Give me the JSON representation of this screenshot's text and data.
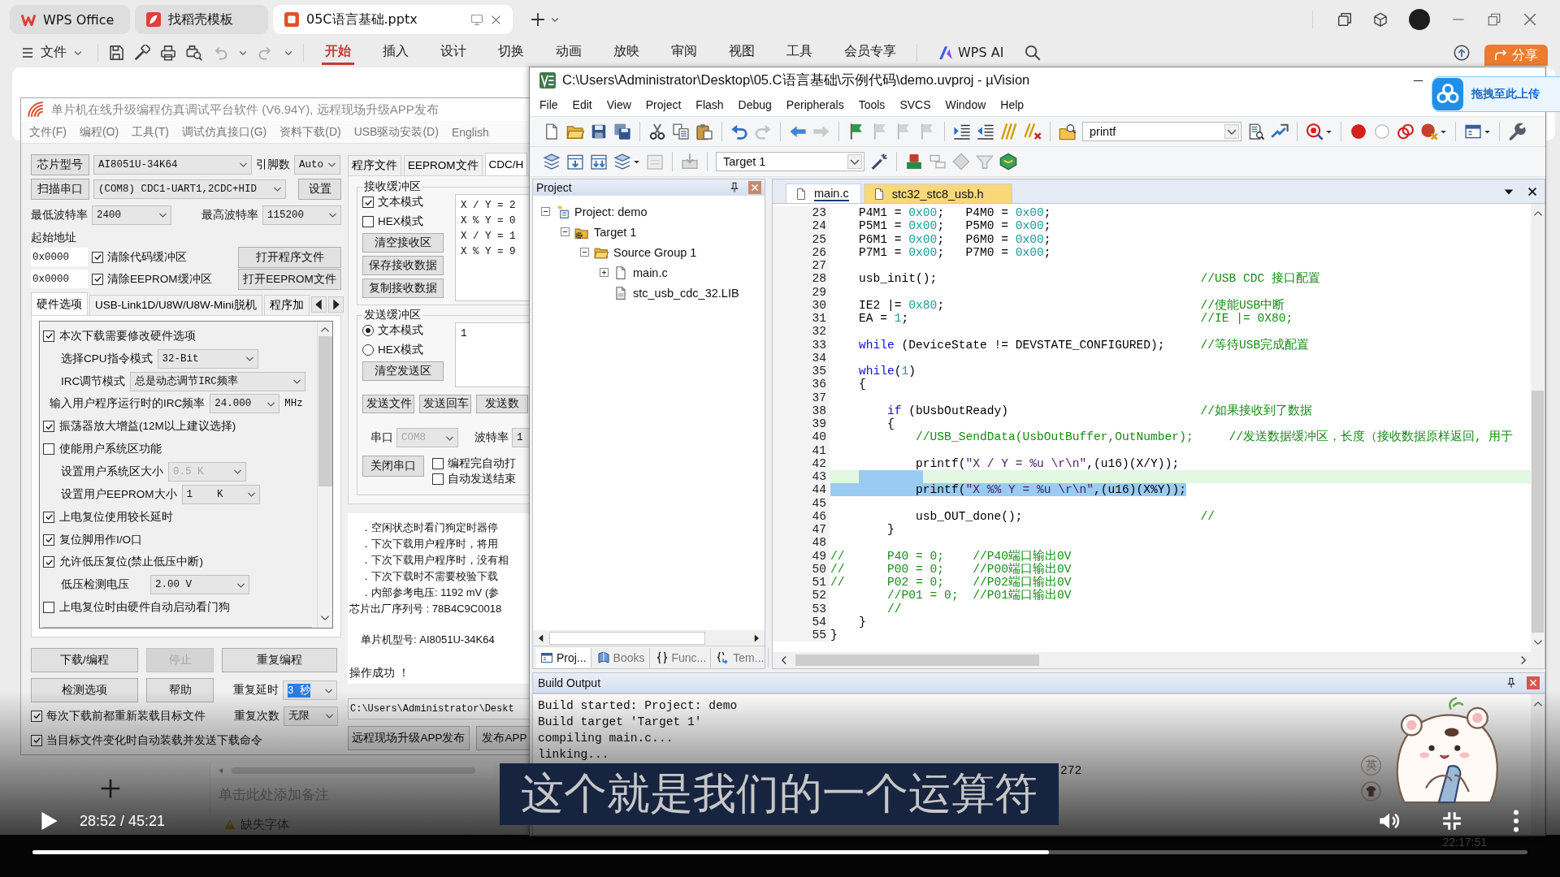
{
  "wps": {
    "tabs": [
      {
        "kind": "home",
        "label": "WPS Office",
        "selected": false
      },
      {
        "kind": "templates",
        "label": "找稻壳模板",
        "selected": false
      },
      {
        "kind": "presentation",
        "label": "05C语言基础.pptx",
        "selected": true
      }
    ],
    "file_menu": "文件",
    "ribbon_tabs": [
      {
        "label": "开始",
        "selected": true
      },
      {
        "label": "插入",
        "selected": false
      },
      {
        "label": "设计",
        "selected": false
      },
      {
        "label": "切换",
        "selected": false
      },
      {
        "label": "动画",
        "selected": false
      },
      {
        "label": "放映",
        "selected": false
      },
      {
        "label": "审阅",
        "selected": false
      },
      {
        "label": "视图",
        "selected": false
      },
      {
        "label": "工具",
        "selected": false
      },
      {
        "label": "会员专享",
        "selected": false
      }
    ],
    "ai_button": "WPS AI",
    "share_button": "分享",
    "notes": {
      "placeholder": "单击此处添加备注"
    },
    "status_warning": "缺失字体"
  },
  "isp": {
    "title": "单片机在线升级编程仿真调试平台软件 (V6.94Y), 远程现场升级APP发布",
    "menu": [
      "文件(F)",
      "编程(O)",
      "工具(T)",
      "调试仿真接口(G)",
      "资料下载(D)",
      "USB驱动安装(D)",
      "English"
    ],
    "chip_button": "芯片型号",
    "chip": "AI8051U-34K64",
    "pins_label": "引脚数",
    "pins": "Auto",
    "scan_button": "扫描串口",
    "port": "(COM8) CDC1-UART1,2CDC+HID",
    "settings_button": "设置",
    "min_baud_label": "最低波特率",
    "min_baud": "2400",
    "max_baud_label": "最高波特率",
    "max_baud": "115200",
    "address_label": "起始地址",
    "address_rows": [
      {
        "address": "0x0000",
        "label": "清除代码缓冲区",
        "checked": true,
        "button": "打开程序文件"
      },
      {
        "address": "0x0000",
        "label": "清除EEPROM缓冲区",
        "checked": true,
        "button": "打开EEPROM文件"
      }
    ],
    "option_tabs": [
      {
        "label": "硬件选项",
        "selected": true
      },
      {
        "label": "USB-Link1D/U8W/U8W-Mini脱机",
        "selected": false
      },
      {
        "label": "程序加",
        "selected": false
      }
    ],
    "options": [
      {
        "kind": "check",
        "label": "本次下载需要修改硬件选项",
        "checked": true
      },
      {
        "kind": "select",
        "label": "选择CPU指令模式",
        "value": "32-Bit",
        "disabled": false
      },
      {
        "kind": "select",
        "label": "IRC调节模式",
        "value": "总是动态调节IRC频率",
        "disabled": false
      },
      {
        "kind": "select",
        "label": "输入用户程序运行时的IRC频率",
        "value": "24.000",
        "unit": "MHz",
        "disabled": false
      },
      {
        "kind": "check",
        "label": "振荡器放大增益(12M以上建议选择)",
        "checked": true
      },
      {
        "kind": "check",
        "label": "使能用户系统区功能",
        "checked": false
      },
      {
        "kind": "select",
        "label": "设置用户系统区大小",
        "value": "0.5 K",
        "disabled": true
      },
      {
        "kind": "select",
        "label": "设置用户EEPROM大小",
        "value": "1    K",
        "disabled": false
      },
      {
        "kind": "check",
        "label": "上电复位使用较长延时",
        "checked": true
      },
      {
        "kind": "check",
        "label": "复位脚用作I/O口",
        "checked": true
      },
      {
        "kind": "check",
        "label": "允许低压复位(禁止低压中断)",
        "checked": true
      },
      {
        "kind": "select",
        "label": "低压检测电压",
        "value": "2.00 V",
        "disabled": false
      },
      {
        "kind": "check",
        "label": "上电复位时由硬件自动启动看门狗",
        "checked": false
      }
    ],
    "action_buttons": [
      {
        "label": "下载/编程",
        "disabled": false
      },
      {
        "label": "停止",
        "disabled": true
      },
      {
        "label": "重复编程",
        "disabled": false
      },
      {
        "label": "检测选项",
        "disabled": false
      },
      {
        "label": "帮助",
        "disabled": false
      }
    ],
    "repeat_delay": {
      "label": "重复延时",
      "value": "3 秒",
      "focused": true
    },
    "repeat_count": {
      "label": "重复次数",
      "value": "无限",
      "focused": false
    },
    "reload_options": [
      {
        "label": "每次下载前都重新装载目标文件",
        "checked": true
      },
      {
        "label": "当目标文件变化时自动装载并发送下载命令",
        "checked": true
      }
    ],
    "tabs": [
      {
        "label": "程序文件",
        "selected": false
      },
      {
        "label": "EEPROM文件",
        "selected": false
      },
      {
        "label": "CDC/H",
        "selected": true
      }
    ],
    "receive": {
      "title": "接收缓冲区",
      "modes": [
        {
          "label": "文本模式",
          "checked": true
        },
        {
          "label": "HEX模式",
          "checked": false
        }
      ],
      "buttons": [
        "清空接收区",
        "保存接收数据",
        "复制接收数据"
      ],
      "lines": [
        "X / Y = 2",
        "X % Y = 0",
        "X / Y = 1",
        "X % Y = 9"
      ]
    },
    "send": {
      "title": "发送缓冲区",
      "modes": [
        {
          "label": "文本模式",
          "selected": true
        },
        {
          "label": "HEX模式",
          "selected": false
        }
      ],
      "clear_button": "清空发送区",
      "value": "1",
      "buttons": [
        "发送文件",
        "发送回车",
        "发送数"
      ]
    },
    "serial": {
      "port_label": "串口",
      "port": {
        "value": "COM8",
        "disabled": true
      },
      "baud_label": "波特率",
      "baud": {
        "value": "1",
        "disabled": false
      },
      "close_button": "关闭串口",
      "options": [
        {
          "label": "编程完自动打",
          "checked": false
        },
        {
          "label": "自动发送结束",
          "checked": false
        }
      ]
    },
    "log": [
      {
        "kind": "note",
        "text": "．空闲状态时看门狗定时器停"
      },
      {
        "kind": "note",
        "text": "．下次下载用户程序时，将用"
      },
      {
        "kind": "note",
        "text": "．下次下载用户程序时，没有相"
      },
      {
        "kind": "note",
        "text": "．下次下载时不需要校验下载"
      },
      {
        "kind": "note",
        "text": "．内部参考电压: 1192 mV (参"
      },
      {
        "kind": "serial",
        "text": "芯片出厂序列号 : 78B4C9C0018"
      },
      {
        "kind": "chip",
        "text": "单片机型号: AI8051U-34K64"
      },
      {
        "kind": "result",
        "text": "操作成功 ！"
      }
    ],
    "path": "C:\\Users\\Administrator\\Deskt",
    "publish_buttons": [
      "远程现场升级APP发布",
      "发布APP"
    ]
  },
  "keil": {
    "title": "C:\\Users\\Administrator\\Desktop\\05.C语言基础\\示例代码\\demo.uvproj - µVision",
    "menu": [
      "File",
      "Edit",
      "View",
      "Project",
      "Flash",
      "Debug",
      "Peripherals",
      "Tools",
      "SVCS",
      "Window",
      "Help"
    ],
    "find": "printf",
    "target": "Target 1",
    "project": {
      "title": "Project",
      "tree": [
        {
          "kind": "project",
          "label": "Project: demo",
          "expanded": true,
          "children": [
            {
              "kind": "target",
              "label": "Target 1",
              "expanded": true,
              "children": [
                {
                  "kind": "group",
                  "label": "Source Group 1",
                  "expanded": true,
                  "children": [
                    {
                      "kind": "file",
                      "label": "main.c",
                      "expanded": false
                    },
                    {
                      "kind": "lib",
                      "label": "stc_usb_cdc_32.LIB"
                    }
                  ]
                }
              ]
            }
          ]
        }
      ],
      "tabs": [
        {
          "kind": "project",
          "label": "Proj...",
          "selected": true
        },
        {
          "kind": "books",
          "label": "Books",
          "selected": false
        },
        {
          "kind": "functions",
          "label": "Func...",
          "selected": false
        },
        {
          "kind": "templates",
          "label": "Tem...",
          "selected": false
        }
      ]
    },
    "editor": {
      "tabs": [
        {
          "label": "main.c",
          "selected": true
        },
        {
          "label": "stc32_stc8_usb.h",
          "selected": false
        }
      ],
      "lines": [
        {
          "n": "23",
          "segs": [
            {
              "kind": "plain",
              "text": "    P4M1 = "
            },
            {
              "kind": "number",
              "text": "0x00"
            },
            {
              "kind": "plain",
              "text": ";   P4M0 = "
            },
            {
              "kind": "number",
              "text": "0x00"
            },
            {
              "kind": "plain",
              "text": ";"
            }
          ]
        },
        {
          "n": "24",
          "segs": [
            {
              "kind": "plain",
              "text": "    P5M1 = "
            },
            {
              "kind": "number",
              "text": "0x00"
            },
            {
              "kind": "plain",
              "text": ";   P5M0 = "
            },
            {
              "kind": "number",
              "text": "0x00"
            },
            {
              "kind": "plain",
              "text": ";"
            }
          ]
        },
        {
          "n": "25",
          "segs": [
            {
              "kind": "plain",
              "text": "    P6M1 = "
            },
            {
              "kind": "number",
              "text": "0x00"
            },
            {
              "kind": "plain",
              "text": ";   P6M0 = "
            },
            {
              "kind": "number",
              "text": "0x00"
            },
            {
              "kind": "plain",
              "text": ";"
            }
          ]
        },
        {
          "n": "26",
          "segs": [
            {
              "kind": "plain",
              "text": "    P7M1 = "
            },
            {
              "kind": "number",
              "text": "0x00"
            },
            {
              "kind": "plain",
              "text": ";   P7M0 = "
            },
            {
              "kind": "number",
              "text": "0x00"
            },
            {
              "kind": "plain",
              "text": ";"
            }
          ]
        },
        {
          "n": "27"
        },
        {
          "n": "28",
          "segs": [
            {
              "kind": "plain",
              "text": "    usb_init();"
            }
          ],
          "note": "//USB CDC 接口配置"
        },
        {
          "n": "29"
        },
        {
          "n": "30",
          "segs": [
            {
              "kind": "plain",
              "text": "    IE2 |= "
            },
            {
              "kind": "number",
              "text": "0x80"
            },
            {
              "kind": "plain",
              "text": ";"
            }
          ],
          "note": "//使能USB中断"
        },
        {
          "n": "31",
          "segs": [
            {
              "kind": "plain",
              "text": "    EA = "
            },
            {
              "kind": "number",
              "text": "1"
            },
            {
              "kind": "plain",
              "text": ";"
            }
          ],
          "note": "//IE |= 0X80;"
        },
        {
          "n": "32"
        },
        {
          "n": "33",
          "segs": [
            {
              "kind": "keyword",
              "text": "    while"
            },
            {
              "kind": "plain",
              "text": " (DeviceState != DEVSTATE_CONFIGURED);"
            }
          ],
          "note": "//等待USB完成配置"
        },
        {
          "n": "34"
        },
        {
          "n": "35",
          "segs": [
            {
              "kind": "keyword",
              "text": "    while"
            },
            {
              "kind": "plain",
              "text": "("
            },
            {
              "kind": "number",
              "text": "1"
            },
            {
              "kind": "plain",
              "text": ")"
            }
          ]
        },
        {
          "n": "36",
          "segs": [
            {
              "kind": "plain",
              "text": "    {"
            }
          ]
        },
        {
          "n": "37"
        },
        {
          "n": "38",
          "segs": [
            {
              "kind": "keyword",
              "text": "        if"
            },
            {
              "kind": "plain",
              "text": " (bUsbOutReady)"
            }
          ],
          "note": "//如果接收到了数据"
        },
        {
          "n": "39",
          "segs": [
            {
              "kind": "plain",
              "text": "        {"
            }
          ]
        },
        {
          "n": "40",
          "segs": [
            {
              "kind": "comment",
              "text": "            //USB_SendData(UsbOutBuffer,OutNumber);     //发送数据缓冲区，长度（接收数据原样返回, 用于"
            }
          ]
        },
        {
          "n": "41"
        },
        {
          "n": "42",
          "segs": [
            {
              "kind": "plain",
              "text": "            printf("
            },
            {
              "kind": "string",
              "text": "\"X / Y = %u \\r\\n\""
            },
            {
              "kind": "plain",
              "text": ",(u16)(X/Y));"
            }
          ]
        },
        {
          "n": "43",
          "current": true,
          "cursor": true,
          "in_selection": true
        },
        {
          "n": "44",
          "in_selection": true,
          "segs": [
            {
              "kind": "plain",
              "text": "            printf("
            },
            {
              "kind": "string",
              "text": "\"X %% Y = %u \\r\\n\""
            },
            {
              "kind": "plain",
              "text": ",(u16)(X%Y));"
            }
          ]
        },
        {
          "n": "45"
        },
        {
          "n": "46",
          "segs": [
            {
              "kind": "plain",
              "text": "            usb_OUT_done();"
            }
          ],
          "note": "//"
        },
        {
          "n": "47",
          "segs": [
            {
              "kind": "plain",
              "text": "        }"
            }
          ]
        },
        {
          "n": "48"
        },
        {
          "n": "49",
          "segs": [
            {
              "kind": "comment",
              "text": "//      P40 = 0;    //P40端口输出0V"
            }
          ]
        },
        {
          "n": "50",
          "segs": [
            {
              "kind": "comment",
              "text": "//      P00 = 0;    //P00端口输出0V"
            }
          ]
        },
        {
          "n": "51",
          "segs": [
            {
              "kind": "comment",
              "text": "//      P02 = 0;    //P02端口输出0V"
            }
          ]
        },
        {
          "n": "52",
          "segs": [
            {
              "kind": "comment",
              "text": "        //P01 = 0;  //P01端口输出0V"
            }
          ]
        },
        {
          "n": "53",
          "segs": [
            {
              "kind": "comment",
              "text": "        //"
            }
          ]
        },
        {
          "n": "54",
          "segs": [
            {
              "kind": "plain",
              "text": "    }"
            }
          ]
        },
        {
          "n": "55",
          "segs": [
            {
              "kind": "plain",
              "text": "}"
            }
          ]
        }
      ]
    },
    "build": {
      "title": "Build Output",
      "lines": [
        "Build started: Project: demo",
        "Build target 'Target 1'",
        "compiling main.c...",
        "linking..."
      ],
      "partial_line": "272"
    }
  },
  "upload_hint": {
    "label": "拖拽至此上传"
  },
  "player": {
    "subtitle": "这个就是我们的一个运算符",
    "time": "28:52 / 45:21",
    "progress": {
      "level": 0.68
    },
    "ime_mode": "英"
  },
  "taskbar": {
    "clock": "22:17:51"
  }
}
